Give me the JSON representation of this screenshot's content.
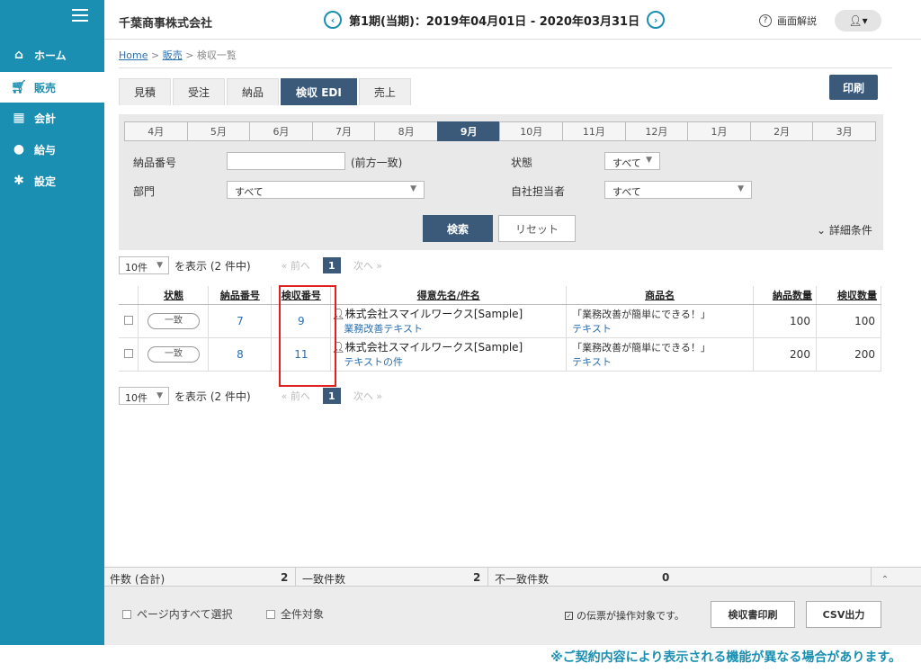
{
  "sidebar": {
    "items": [
      {
        "label": "ホーム",
        "icon": "home-icon"
      },
      {
        "label": "販売",
        "icon": "cart-icon"
      },
      {
        "label": "会計",
        "icon": "calculator-icon"
      },
      {
        "label": "給与",
        "icon": "moneybag-icon"
      },
      {
        "label": "設定",
        "icon": "gear-icon"
      }
    ],
    "active_color": "#1a8fb2"
  },
  "header": {
    "company": "千葉商事株式会社",
    "period": "第1期(当期)：2019年04月01日 - 2020年03月31日",
    "help_label": "画面解説"
  },
  "breadcrumb": {
    "home": "Home",
    "sales": "販売",
    "current": "検収一覧"
  },
  "tabs": [
    "見積",
    "受注",
    "納品",
    "検収 EDI",
    "売上"
  ],
  "print_label": "印刷",
  "search": {
    "months": [
      "4月",
      "5月",
      "6月",
      "7月",
      "8月",
      "9月",
      "10月",
      "11月",
      "12月",
      "1月",
      "2月",
      "3月"
    ],
    "active_month": "9月",
    "delivery_no_label": "納品番号",
    "prefix_match": "(前方一致)",
    "status_label": "状態",
    "status_value": "すべて",
    "dept_label": "部門",
    "dept_value": "すべて",
    "staff_label": "自社担当者",
    "staff_value": "すべて",
    "search_btn": "検索",
    "reset_btn": "リセット",
    "detail_label": "詳細条件"
  },
  "pager": {
    "per_page": "10件",
    "showing": "を表示 (2 件中)",
    "prev": "« 前へ",
    "page": "1",
    "next": "次へ »"
  },
  "table": {
    "headers": [
      "状態",
      "納品番号",
      "検収番号",
      "得意先名/件名",
      "商品名",
      "納品数量",
      "検収数量"
    ],
    "rows": [
      {
        "status": "一致",
        "delivery_no": "7",
        "inspection_no": "9",
        "customer": "株式会社スマイルワークス[Sample]",
        "subject": "業務改善テキスト",
        "product": "「業務改善が簡単にできる！」",
        "product_sub": "テキスト",
        "delivery_qty": "100",
        "inspection_qty": "100"
      },
      {
        "status": "一致",
        "delivery_no": "8",
        "inspection_no": "11",
        "customer": "株式会社スマイルワークス[Sample]",
        "subject": "テキストの件",
        "product": "「業務改善が簡単にできる！」",
        "product_sub": "テキスト",
        "delivery_qty": "200",
        "inspection_qty": "200"
      }
    ]
  },
  "summary": {
    "count_label": "件数 (合計)",
    "count": "2",
    "match_label": "一致件数",
    "match": "2",
    "mismatch_label": "不一致件数",
    "mismatch": "0"
  },
  "footer": {
    "select_page": "ページ内すべて選択",
    "select_all": "全件対象",
    "op_note": "の伝票が操作対象です。",
    "print_btn": "検収書印刷",
    "csv_btn": "CSV出力"
  },
  "notice": "※ご契約内容により表示される機能が異なる場合があります。"
}
